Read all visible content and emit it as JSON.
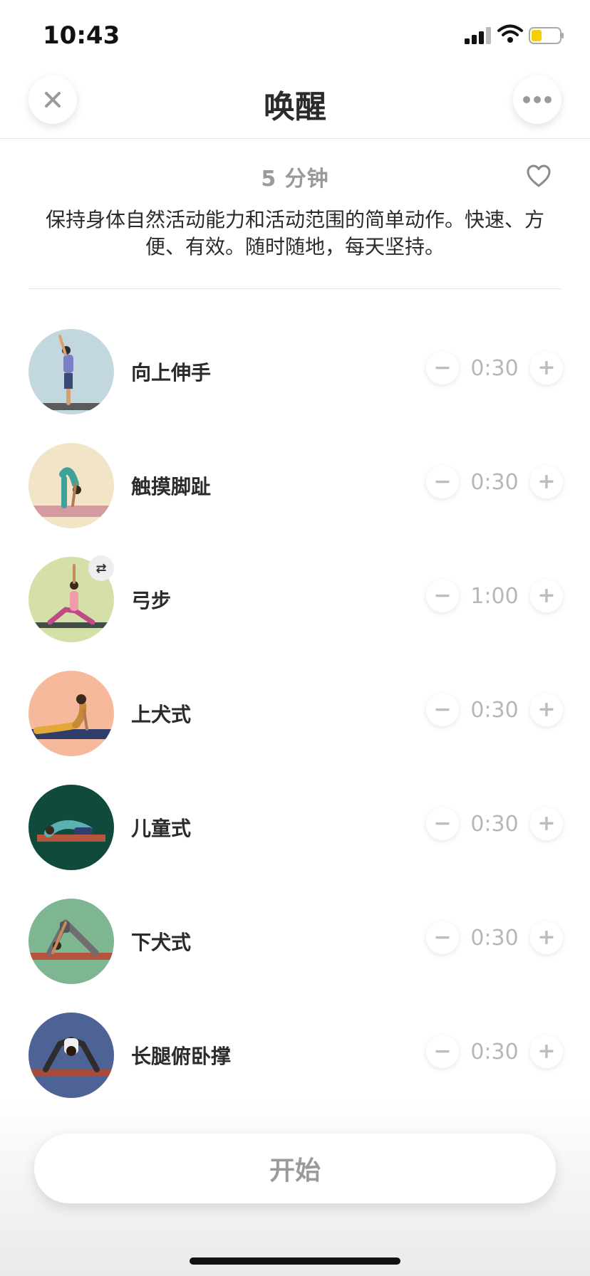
{
  "status": {
    "time": "10:43"
  },
  "nav": {
    "title": "唤醒"
  },
  "summary": {
    "duration": "5 分钟",
    "description": "保持身体自然活动能力和活动范围的简单动作。快速、方便、有效。随时随地，每天坚持。"
  },
  "exercises": [
    {
      "name": "向上伸手",
      "time": "0:30",
      "bg": "#c3d8de"
    },
    {
      "name": "触摸脚趾",
      "time": "0:30",
      "bg": "#f2e4c6"
    },
    {
      "name": "弓步",
      "time": "1:00",
      "bg": "#d5e0a8",
      "switch_sides": true
    },
    {
      "name": "上犬式",
      "time": "0:30",
      "bg": "#f7b99c"
    },
    {
      "name": "儿童式",
      "time": "0:30",
      "bg": "#0f4a3c"
    },
    {
      "name": "下犬式",
      "time": "0:30",
      "bg": "#7fb692"
    },
    {
      "name": "长腿俯卧撑",
      "time": "0:30",
      "bg": "#4d6396"
    }
  ],
  "actions": {
    "start_label": "开始"
  },
  "stepper": {
    "minus": "−",
    "plus": "+"
  },
  "icons": {
    "close": "close-icon",
    "more": "more-icon",
    "heart": "heart-outline-icon",
    "switch": "switch-sides-icon"
  }
}
